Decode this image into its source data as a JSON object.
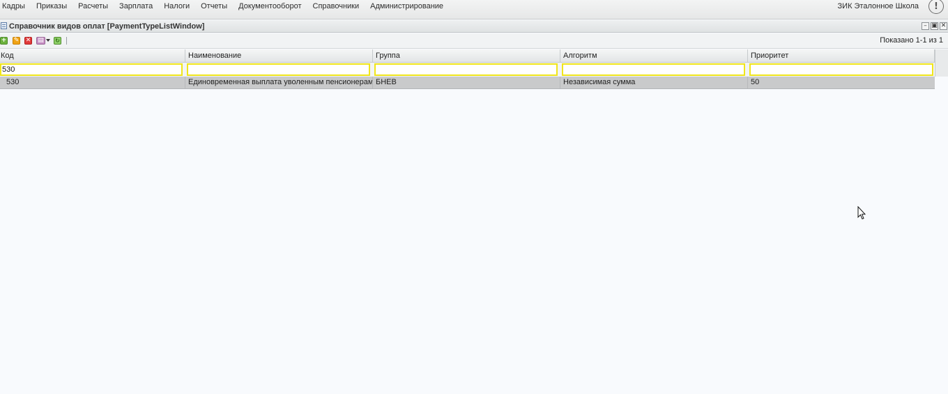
{
  "menu": {
    "items": [
      {
        "label": "Кадры"
      },
      {
        "label": "Приказы"
      },
      {
        "label": "Расчеты"
      },
      {
        "label": "Зарплата"
      },
      {
        "label": "Налоги"
      },
      {
        "label": "Отчеты"
      },
      {
        "label": "Документооборот"
      },
      {
        "label": "Справочники"
      },
      {
        "label": "Администрирование"
      }
    ],
    "org_name": "ЗИК Эталонное Школа",
    "info_icon": "!"
  },
  "window": {
    "title": "Справочник видов оплат [PaymentTypeListWindow]",
    "controls": {
      "minimize": "–",
      "restore": "▣",
      "close": "✕"
    }
  },
  "toolbar": {
    "add_icon": "+",
    "edit_icon": "✎",
    "delete_icon": "✕",
    "print_icon": "▤",
    "refresh_icon": "↻",
    "paging_text": "Показано 1-1 из 1"
  },
  "grid": {
    "columns": [
      "Код",
      "Наименование",
      "Группа",
      "Алгоритм",
      "Приоритет"
    ],
    "filters": [
      "530",
      "",
      "",
      "",
      ""
    ],
    "rows": [
      [
        "530",
        "Единовременная выплата уволенным пенсионерам",
        "БНЕВ",
        "Независимая сумма",
        "50"
      ]
    ]
  },
  "colors": {
    "filter_border": "#f0e51a",
    "selected_row": "#c9cacb"
  }
}
